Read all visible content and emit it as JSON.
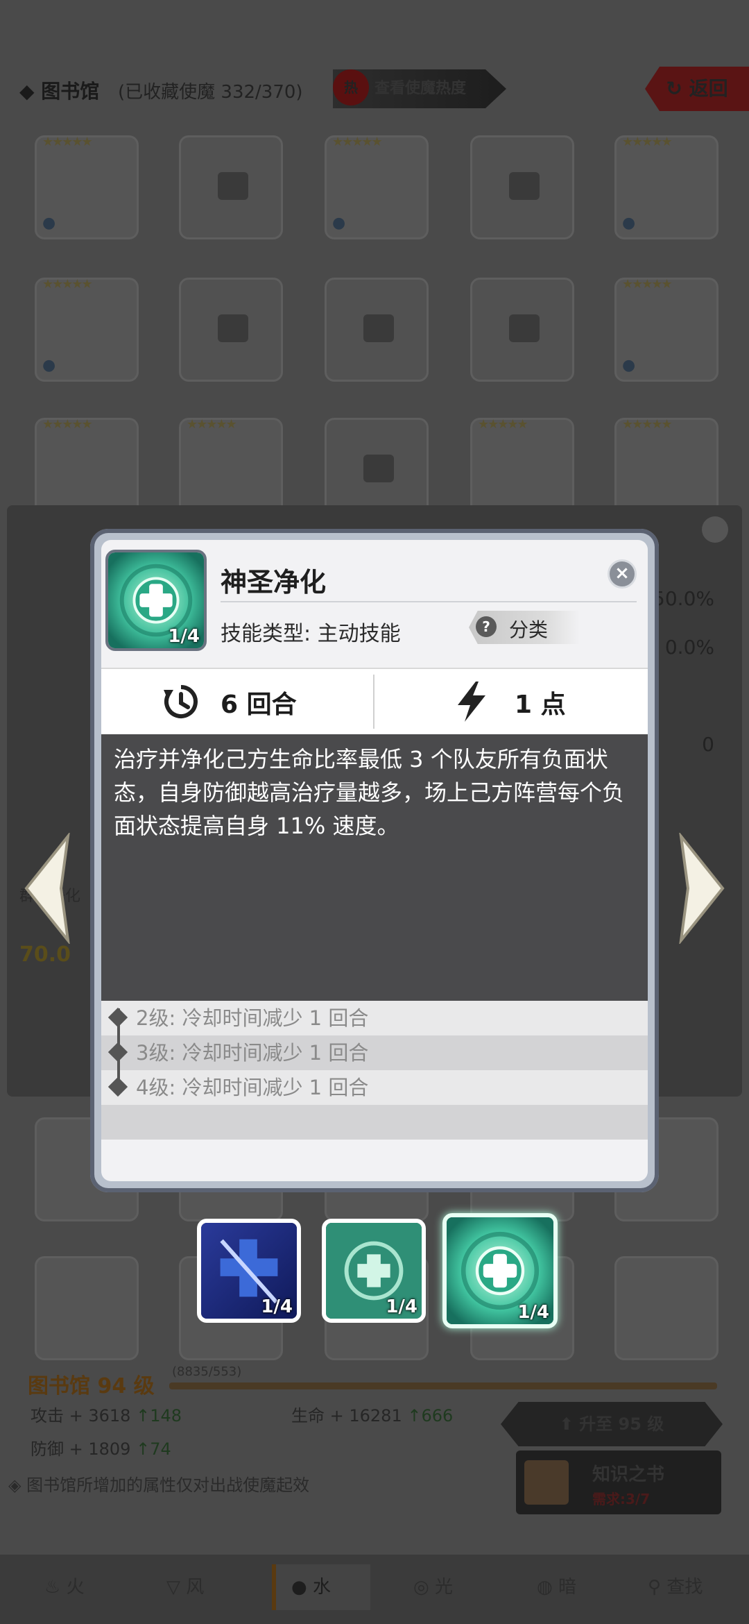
{
  "topbar": {
    "title": "图书馆",
    "subtitle": "(已收藏使魔 332/370)",
    "hot_badge": "热",
    "hot_label": "查看使魔热度",
    "back_label": "返回"
  },
  "side_panel": {
    "right_values": [
      "50.0%",
      "0.0%",
      "0"
    ],
    "left_label": "群体净化",
    "left_value": "70.0"
  },
  "dialog": {
    "skill_name": "神圣净化",
    "skill_type_label": "技能类型:",
    "skill_type_value": "主动技能",
    "category_label": "分类",
    "help_glyph": "?",
    "close_glyph": "×",
    "icon_fraction": "1/4",
    "cooldown": "6 回合",
    "cost": "1 点",
    "description": "治疗并净化己方生命比率最低 3 个队友所有负面状态，自身防御越高治疗量越多，场上己方阵营每个负面状态提高自身 11% 速度。",
    "levels": [
      "2级:  冷却时间减少 1 回合",
      "3级:  冷却时间减少 1 回合",
      "4级:  冷却时间减少 1 回合"
    ]
  },
  "skill_slots": [
    {
      "fraction": "1/4",
      "icon": "cross-slash-icon"
    },
    {
      "fraction": "1/4",
      "icon": "heal-circle-icon"
    },
    {
      "fraction": "1/4",
      "icon": "holy-purify-icon"
    }
  ],
  "library": {
    "level": "图书馆 94 级",
    "exp": "(8835/553)",
    "attack": "攻击 + 3618",
    "attack_inc": "↑148",
    "hp": "生命 + 16281",
    "hp_inc": "↑666",
    "defense": "防御 + 1809",
    "defense_inc": "↑74",
    "upgrade_label": "升至 95 级",
    "knowledge_title": "知识之书",
    "knowledge_need": "需求:3/7",
    "notice": "图书馆所增加的属性仅对出战使魔起效"
  },
  "tabs": [
    {
      "label": "火",
      "icon": "fire-icon"
    },
    {
      "label": "风",
      "icon": "wind-icon"
    },
    {
      "label": "水",
      "icon": "water-icon"
    },
    {
      "label": "光",
      "icon": "light-icon"
    },
    {
      "label": "暗",
      "icon": "dark-icon"
    },
    {
      "label": "查找",
      "icon": "search-icon"
    }
  ],
  "colors": {
    "accent_teal": "#3fbf9c",
    "dialog_frame": "#5b6272",
    "desc_bg": "#4a4a4c"
  }
}
